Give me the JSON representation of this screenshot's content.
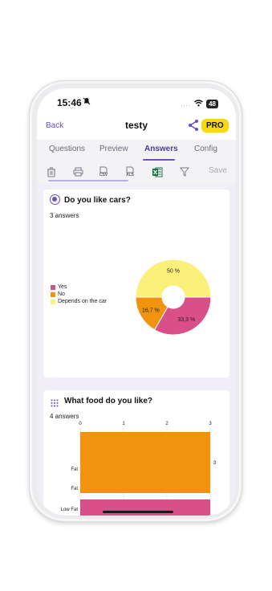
{
  "status": {
    "time": "15:46",
    "bell_icon": "bell-slash-icon",
    "dots": "....",
    "battery": "48"
  },
  "appbar": {
    "back_label": "Back",
    "title": "testy",
    "pro_label": "PRO",
    "share_icon": "share-icon"
  },
  "tabs": [
    {
      "label": "Questions",
      "active": false
    },
    {
      "label": "Preview",
      "active": false
    },
    {
      "label": "Answers",
      "active": true
    },
    {
      "label": "Config",
      "active": false
    }
  ],
  "toolbar": {
    "icons": [
      "trash-icon",
      "print-icon",
      "csv-file-icon",
      "xls-file-icon",
      "excel-icon",
      "filter-icon"
    ],
    "csv_label": "CSV",
    "xls_label": "XLS",
    "save_label": "Save"
  },
  "colors": {
    "accent": "#6a4fc7",
    "yes": "#d94f8a",
    "no": "#f2930f",
    "depends": "#fbf07a",
    "pro": "#f8d90f"
  },
  "questions": [
    {
      "title": "Do you like cars?",
      "answers_text": "3 answers",
      "icon": "radio-icon"
    },
    {
      "title": "What food do you like?",
      "answers_text": "4 answers",
      "icon": "grid-icon"
    }
  ],
  "chart_data": [
    {
      "type": "pie",
      "title": "",
      "categories": [
        "Yes",
        "No",
        "Depends on the car"
      ],
      "values": [
        33.3,
        16.7,
        50
      ],
      "labels": [
        "33,3 %",
        "16,7 %",
        "50 %"
      ],
      "colors": [
        "#d94f8a",
        "#f2930f",
        "#fbf07a"
      ],
      "legend": "left"
    },
    {
      "type": "bar",
      "orientation": "horizontal",
      "title": "",
      "categories": [
        "Fat",
        "Fat",
        "Low Fat"
      ],
      "x_ticks": [
        0,
        1,
        2,
        3
      ],
      "xlim": [
        0,
        3
      ],
      "series": [
        {
          "values": [
            3,
            3,
            1
          ],
          "colors": [
            "#f2930f",
            "#f2930f",
            "#d94f8a"
          ]
        }
      ],
      "data_labels": [
        "3"
      ]
    }
  ]
}
